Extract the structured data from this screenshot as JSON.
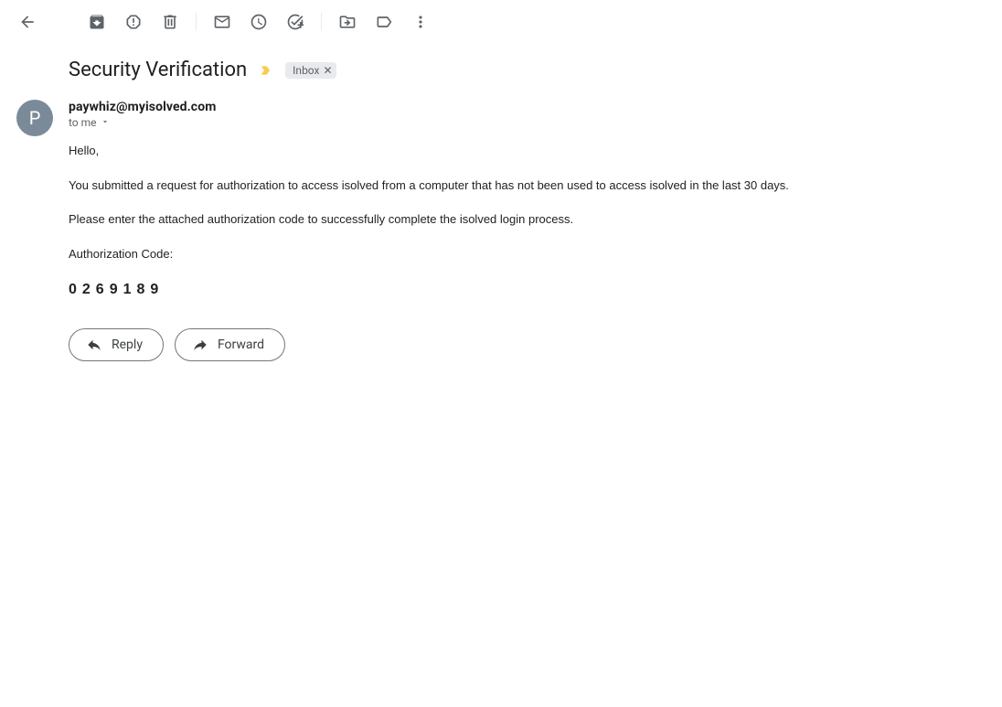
{
  "subject": "Security Verification",
  "label": "Inbox",
  "sender": {
    "email": "paywhiz@myisolved.com",
    "initial": "P"
  },
  "recipients_line": "to me",
  "body": {
    "greeting": "Hello,",
    "p1": "You submitted a request for authorization to access isolved from a computer that has not been used to access isolved in the last 30 days.",
    "p2": "Please enter the attached authorization code to successfully complete the isolved login process.",
    "code_label": "Authorization Code:",
    "auth_code": "0269189"
  },
  "actions": {
    "reply": "Reply",
    "forward": "Forward"
  }
}
